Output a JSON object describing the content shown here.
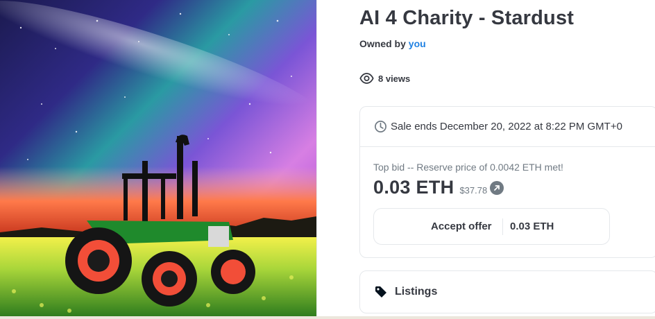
{
  "item": {
    "title": "AI 4 Charity - Stardust",
    "owned_by_prefix": "Owned by",
    "owner_link": "you",
    "views": "8 views"
  },
  "sale": {
    "ends_text": "Sale ends December 20, 2022 at 8:22 PM GMT+0",
    "top_bid_label": "Top bid -- Reserve price of 0.0042 ETH met!",
    "price": "0.03 ETH",
    "usd": "$37.78",
    "accept_label": "Accept offer",
    "accept_amount": "0.03 ETH"
  },
  "listings": {
    "label": "Listings"
  },
  "icons": {
    "views": "eye-icon",
    "sale": "clock-icon",
    "usd_link": "external-link-icon",
    "listings": "tag-icon"
  },
  "colors": {
    "text": "#353840",
    "muted": "#707a83",
    "link": "#2081e2",
    "border": "#e5e8eb"
  }
}
